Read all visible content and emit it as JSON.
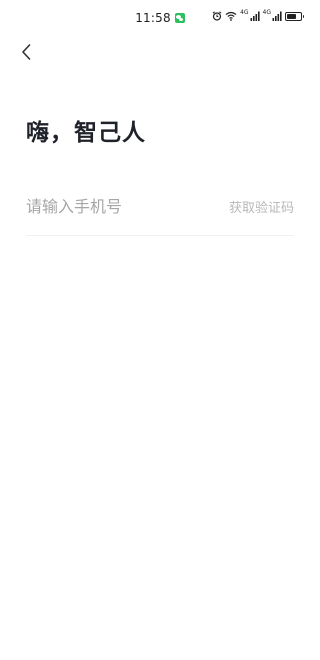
{
  "status_bar": {
    "time": "11:58",
    "network_1": "4G",
    "network_2": "4G",
    "icons": [
      "wechat-notification-icon",
      "alarm-icon",
      "wifi-icon",
      "signal-icon",
      "signal-icon",
      "battery-icon"
    ],
    "battery_level": 0.7
  },
  "header": {
    "back_icon": "chevron-left-icon"
  },
  "main": {
    "greeting": "嗨，智己人",
    "phone_placeholder": "请输入手机号",
    "phone_value": "",
    "get_code_label": "获取验证码"
  },
  "colors": {
    "title": "#1f2329",
    "placeholder": "#a6a6a6",
    "code_button": "#b8b8b8",
    "divider": "#f0f0f0",
    "wechat": "#2bbf5d"
  }
}
